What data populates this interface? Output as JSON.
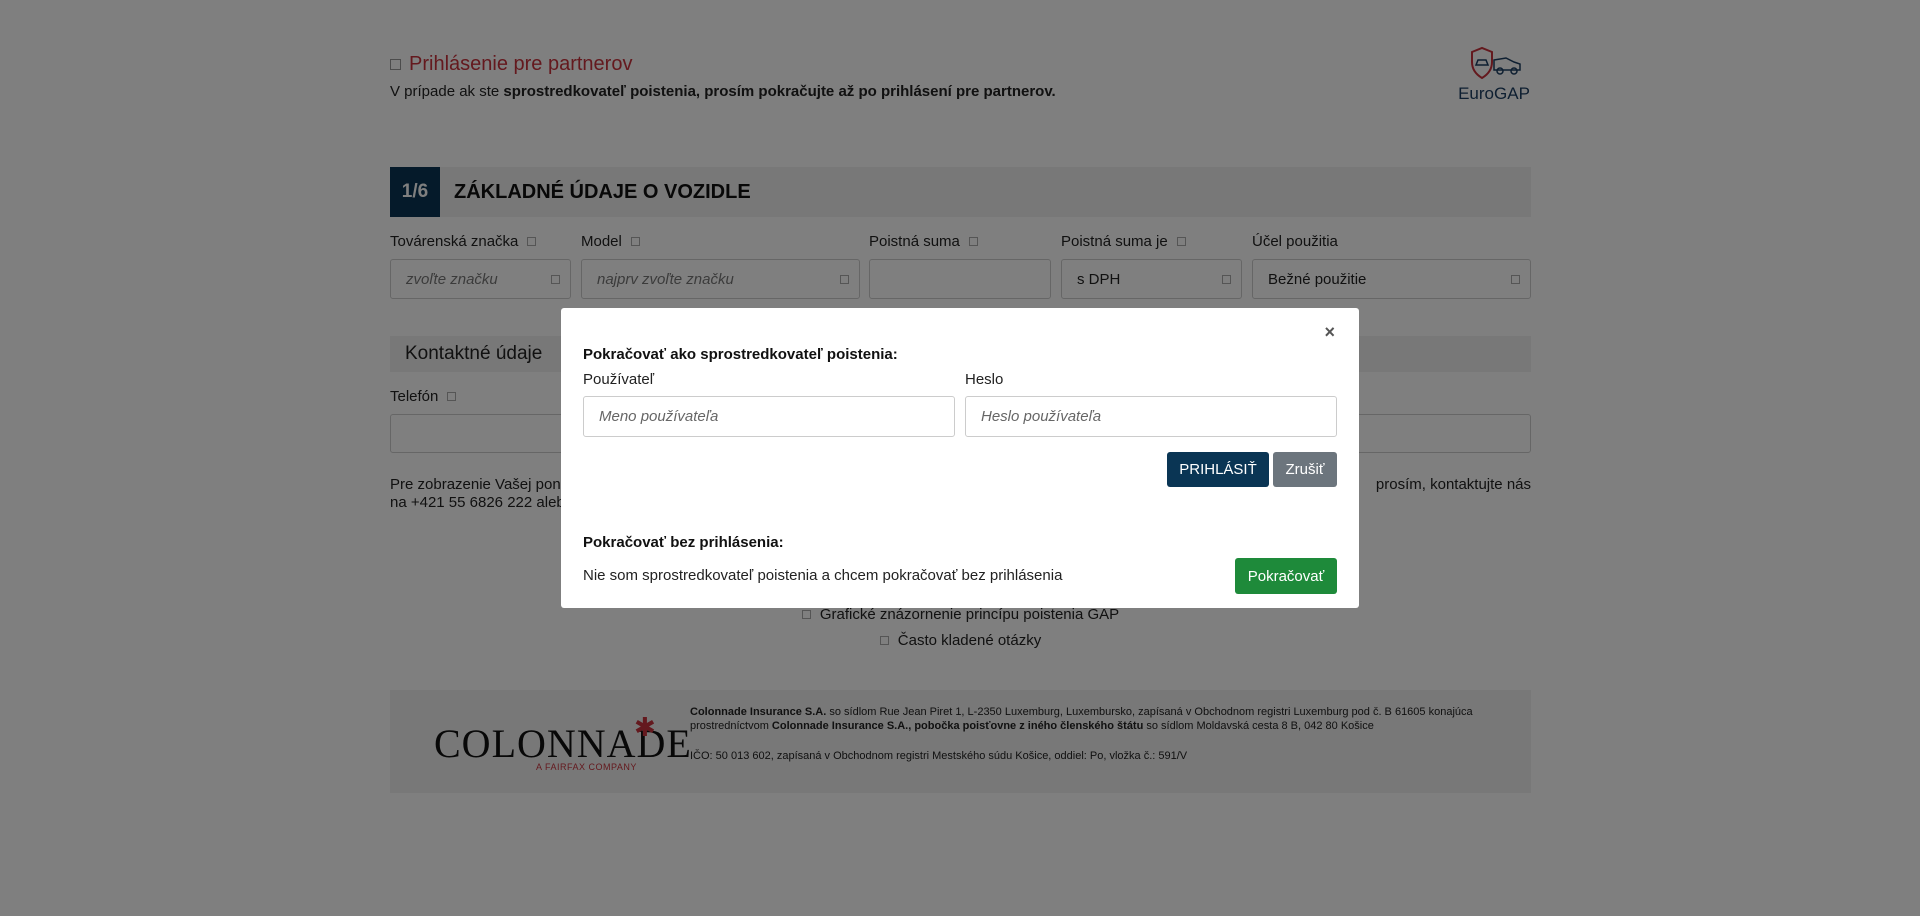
{
  "partner": {
    "link_label": "Prihlásenie pre partnerov",
    "note_prefix": "V prípade ak ste ",
    "note_bold": "sprostredkovateľ poistenia, prosím pokračujte až po prihlásení pre partnerov."
  },
  "logo": {
    "text": "EuroGAP"
  },
  "section": {
    "step": "1/6",
    "title": "ZÁKLADNÉ ÚDAJE O VOZIDLE"
  },
  "fields": {
    "brand": {
      "label": "Továrenská značka",
      "placeholder": "zvoľte značku"
    },
    "model": {
      "label": "Model",
      "placeholder": "najprv zvoľte značku"
    },
    "sum": {
      "label": "Poistná suma",
      "value": ""
    },
    "sum_is": {
      "label": "Poistná suma je",
      "value": "s DPH"
    },
    "purpose": {
      "label": "Účel použitia",
      "value": "Bežné použitie"
    }
  },
  "contact": {
    "title": "Kontaktné údaje",
    "phone_label": "Telefón"
  },
  "info": {
    "line1_left": "Pre zobrazenie Vašej pon",
    "line1_right": "prosím, kontaktujte nás",
    "line2": "na +421 55 6826 222 aleb"
  },
  "links": {
    "graphic": "Grafické znázornenie princípu poistenia GAP",
    "faq": "Často kladené otázky"
  },
  "footer": {
    "brand_name": "COLONNADE",
    "brand_sub": "A FAIRFAX COMPANY",
    "legal_b1": "Colonnade Insurance S.A.",
    "legal_t1": " so sídlom Rue Jean Piret 1, L-2350 Luxemburg, Luxembursko, zapísaná v Obchodnom registri Luxemburg pod č. B 61605 konajúca prostredníctvom ",
    "legal_b2": "Colonnade Insurance S.A., pobočka poisťovne z iného členského štátu",
    "legal_t2": " so sídlom Moldavská cesta 8 B, 042 80 Košice",
    "legal_ico": "IČO: 50 013 602, zapísaná v Obchodnom registri Mestského súdu Košice, oddiel: Po, vložka č.: 591/V"
  },
  "modal": {
    "close": "×",
    "title_login": "Pokračovať ako sprostredkovateľ poistenia:",
    "user_label": "Používateľ",
    "user_placeholder": "Meno používateľa",
    "pass_label": "Heslo",
    "pass_placeholder": "Heslo používateľa",
    "login_button": "PRIHLÁSIŤ",
    "cancel_button": "Zrušiť",
    "title_guest": "Pokračovať bez prihlásenia:",
    "guest_text": "Nie som sprostredkovateľ poistenia a chcem pokračovať bez prihlásenia",
    "continue_button": "Pokračovať"
  },
  "colors": {
    "accent_navy": "#0a3554",
    "partner_red": "#c8323c",
    "continue_green": "#1e8a3a",
    "cancel_gray": "#6c757d"
  }
}
